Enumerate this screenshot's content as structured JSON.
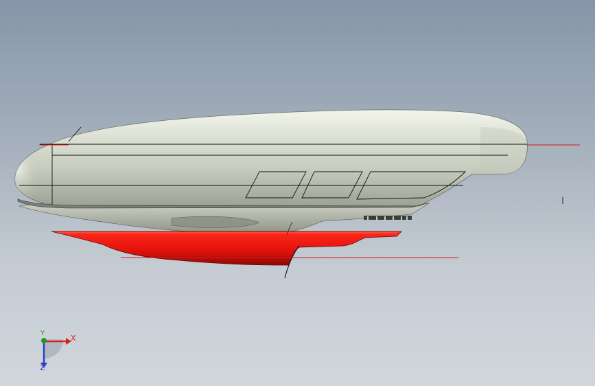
{
  "viewport": {
    "background_top": "#8595a7",
    "background_bottom": "#d1d6dc"
  },
  "model": {
    "hull_color": "#d9ddd0",
    "hull_shadow_color": "#9ea398",
    "hull_highlight_color": "#f4f6ee",
    "keel_color": "#e8160f",
    "keel_dark_color": "#a30c07",
    "reference_line_color": "#d81818",
    "edge_color": "#111111",
    "window_count": 3
  },
  "triad": {
    "x_label": "X",
    "y_label": "Y",
    "z_label": "Z",
    "x_color": "#d42020",
    "y_color": "#1f9a2a",
    "z_color": "#2a3fc8"
  }
}
